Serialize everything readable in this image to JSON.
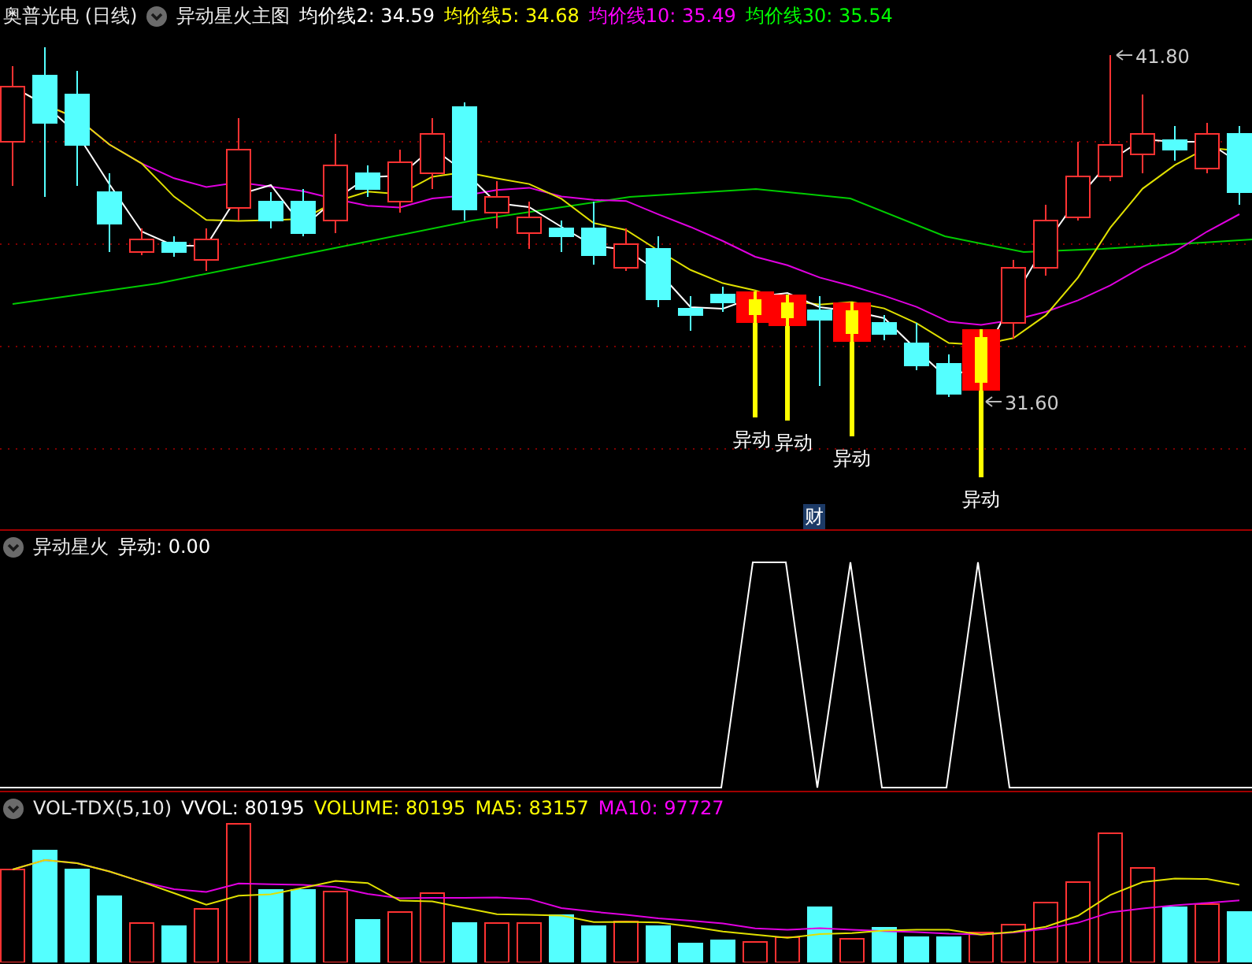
{
  "main_panel": {
    "stock": "奥普光电 (日线)",
    "indicator": "异动星火主图",
    "values": [
      {
        "label": "均价线2: 34.59",
        "color": "#ffffff"
      },
      {
        "label": "均价线5: 34.68",
        "color": "#ffff00"
      },
      {
        "label": "均价线10: 35.49",
        "color": "#ff00ff"
      },
      {
        "label": "均价线30: 35.54",
        "color": "#00ff00"
      }
    ],
    "high_label": "41.80",
    "low_label": "31.60",
    "signals": [
      {
        "label": "异动"
      },
      {
        "label": "异动"
      },
      {
        "label": "异动"
      },
      {
        "label": "异动"
      }
    ],
    "badge": "财"
  },
  "signal_panel": {
    "indicator": "异动星火",
    "values": [
      {
        "label": "异动: 0.00",
        "color": "#ffffff"
      }
    ]
  },
  "volume_panel": {
    "indicator": "VOL-TDX(5,10)",
    "values": [
      {
        "label": "VVOL: 80195",
        "color": "#ffffff"
      },
      {
        "label": "VOLUME: 80195",
        "color": "#ffff00"
      },
      {
        "label": "MA5: 83157",
        "color": "#ffff00"
      },
      {
        "label": "MA10: 97727",
        "color": "#ff00ff"
      }
    ]
  }
}
